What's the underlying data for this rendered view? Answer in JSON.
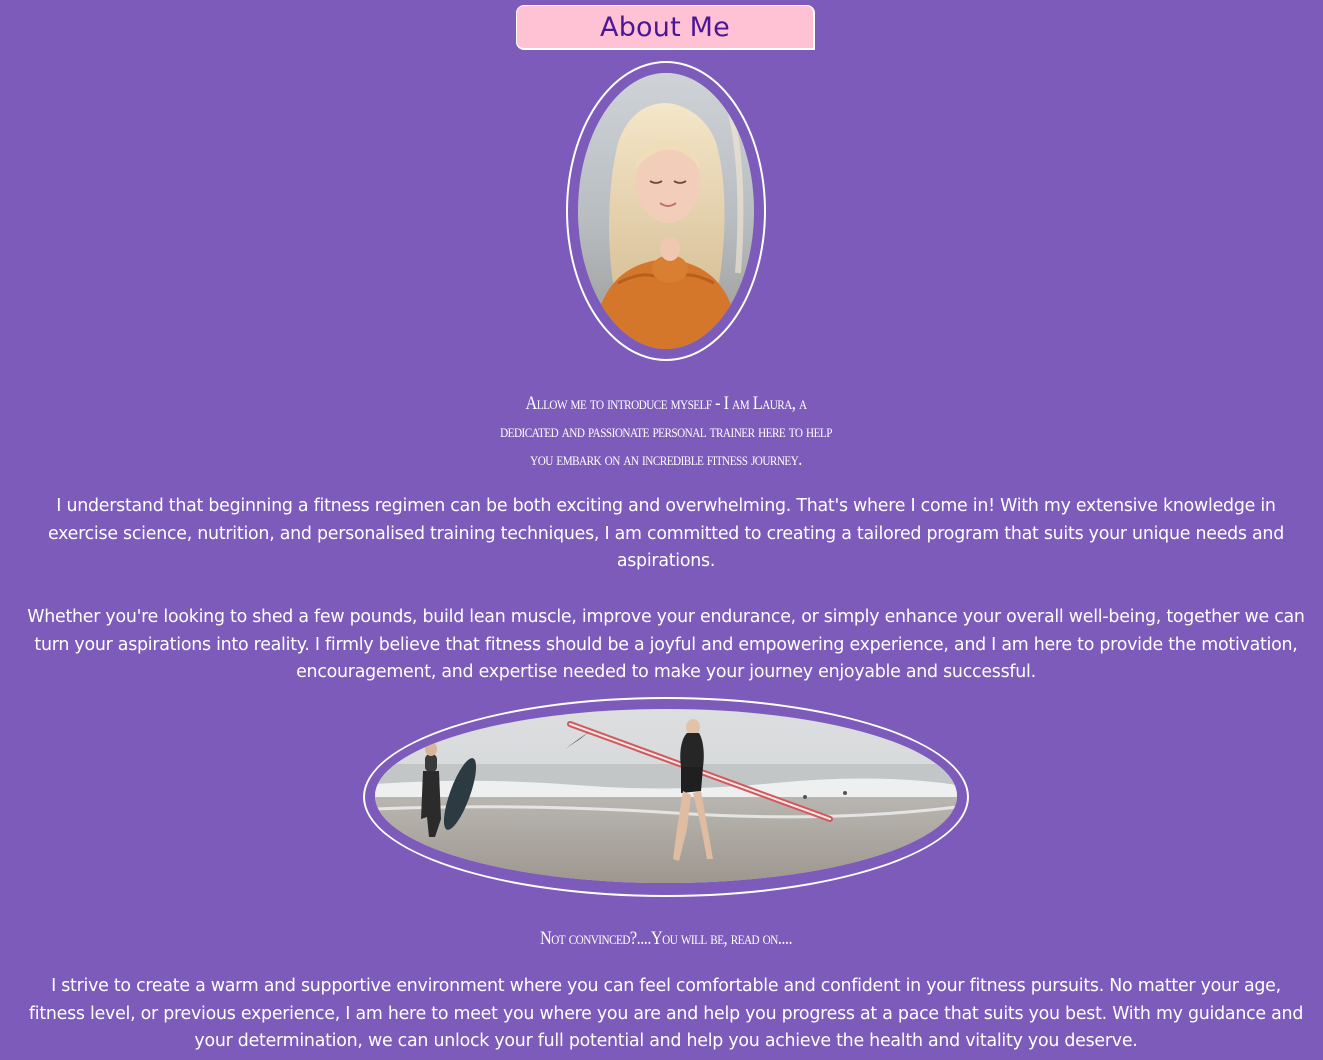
{
  "section": {
    "title": "About Me"
  },
  "images": {
    "portrait": "portrait-photo",
    "surfers": "surfers-photo"
  },
  "intro": "Allow me to introduce myself - I am Laura, a dedicated and passionate personal trainer here to help you embark on an incredible fitness journey.",
  "paragraphs": [
    "I understand that beginning a fitness regimen can be both exciting and overwhelming. That's where I come in! With my extensive knowledge in exercise science, nutrition, and personalised training techniques, I am committed to creating a tailored program that suits your unique needs and aspirations.",
    "Whether you're looking to shed a few pounds, build lean muscle, improve your endurance, or simply enhance your overall well-being, together we can turn your aspirations into reality. I firmly believe that fitness should be a joyful and empowering experience, and I am here to provide the motivation, encouragement, and expertise needed to make your journey enjoyable and successful.",
    "I strive to create a warm and supportive environment where you can feel comfortable and confident in your fitness pursuits. No matter your age, fitness level, or previous experience, I am here to meet you where you are and help you progress at a pace that suits you best. With my guidance and your determination, we can unlock your full potential and help you achieve the health and vitality you deserve."
  ],
  "teaser": "Not convinced?....You will be, read on....",
  "colors": {
    "background": "#7d5bba",
    "title_box": "#ffc2d4",
    "title_text": "#4b1697",
    "text": "#ffffff"
  }
}
